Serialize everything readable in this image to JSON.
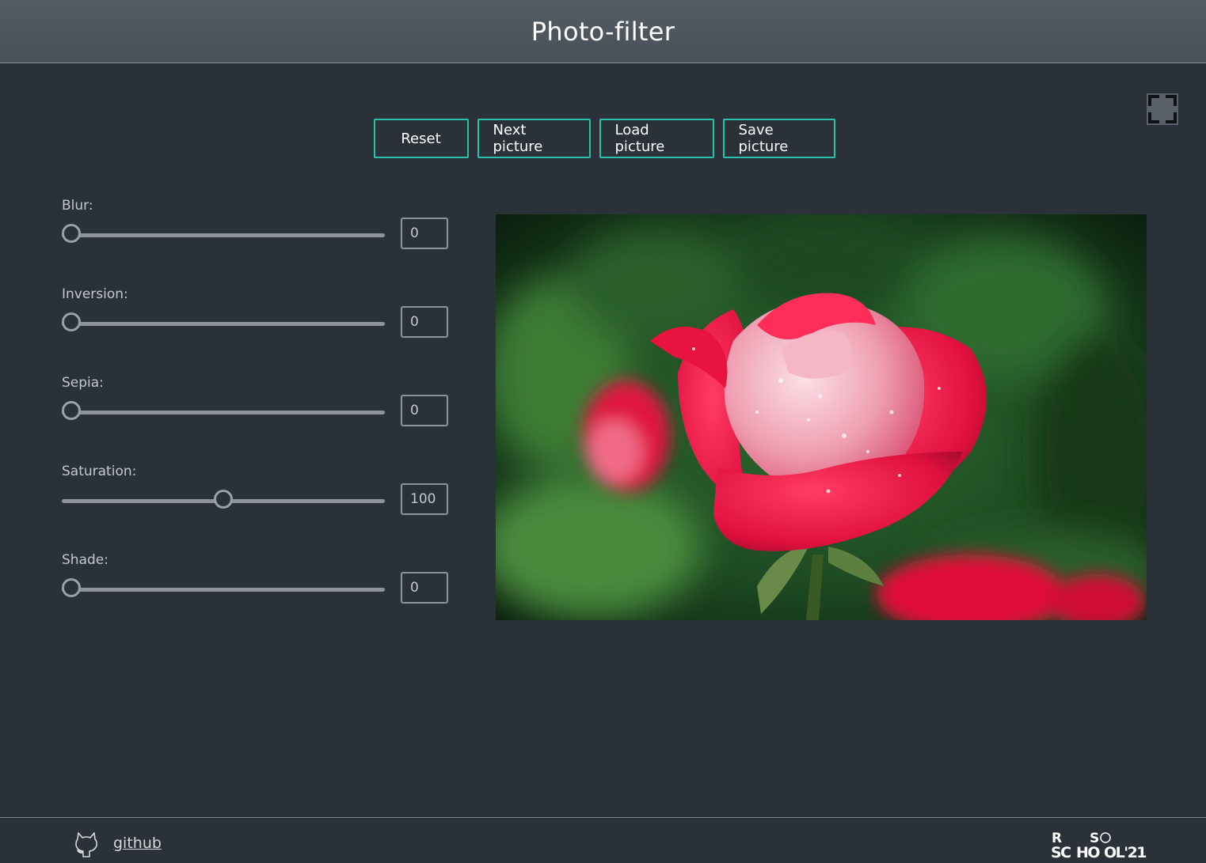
{
  "header": {
    "title": "Photo-filter"
  },
  "toolbar": {
    "reset_label": "Reset",
    "next_label": "Next picture",
    "load_label": "Load picture",
    "save_label": "Save picture"
  },
  "filters": [
    {
      "label": "Blur:",
      "value": "0",
      "fraction": 0.0
    },
    {
      "label": "Inversion:",
      "value": "0",
      "fraction": 0.0
    },
    {
      "label": "Sepia:",
      "value": "0",
      "fraction": 0.0
    },
    {
      "label": "Saturation:",
      "value": "100",
      "fraction": 0.5
    },
    {
      "label": "Shade:",
      "value": "0",
      "fraction": 0.0
    }
  ],
  "footer": {
    "github_label": "github",
    "logo_text": "RS SCHOOL'21"
  },
  "colors": {
    "background": "#2a3139",
    "header": "#4b535b",
    "accent": "#28c2ac",
    "slider": "#8d9399"
  },
  "icons": {
    "fullscreen": "fullscreen-icon",
    "github": "github-icon"
  }
}
